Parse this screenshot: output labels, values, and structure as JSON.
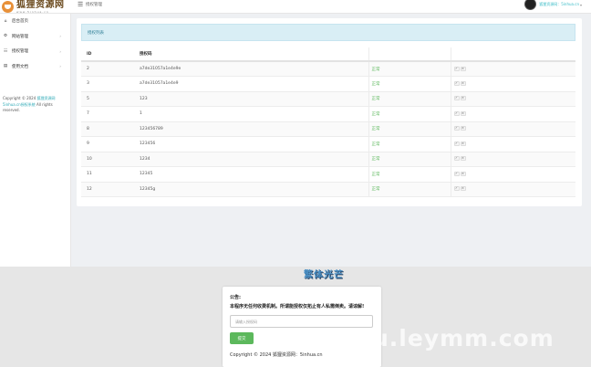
{
  "header": {
    "logo_main": "狐狸资源网",
    "logo_sub": "www.5inhua.cn",
    "menu_icon": "hamburger-icon",
    "page_title": "授权管理",
    "user_name": "狐狸资源网：5inhua.cn",
    "user_caret": "▾"
  },
  "sidebar": {
    "items": [
      {
        "icon": "home-icon",
        "glyph": "⌂",
        "label": "后台首页",
        "arrow": ""
      },
      {
        "icon": "cog-icon",
        "glyph": "⚙",
        "label": "网站管理",
        "arrow": "›"
      },
      {
        "icon": "users-icon",
        "glyph": "☷",
        "label": "授权管理",
        "arrow": "›"
      },
      {
        "icon": "document-icon",
        "glyph": "▤",
        "label": "使用文档",
        "arrow": "›"
      }
    ],
    "copyright_prefix": "Copyright © 2024 ",
    "copyright_link": "狐狸资源网 5inhua.cn授权系统",
    "copyright_suffix": " All rights reserved."
  },
  "main": {
    "alert_text": "授权列表",
    "table": {
      "headers": [
        "ID",
        "授权码",
        "",
        ""
      ],
      "rows": [
        {
          "id": "2",
          "code": "a7de31057a1e4e9e",
          "status": "正常"
        },
        {
          "id": "3",
          "code": "a7de31057a1e4e9",
          "status": "正常"
        },
        {
          "id": "5",
          "code": "123",
          "status": "正常"
        },
        {
          "id": "7",
          "code": "1",
          "status": "正常"
        },
        {
          "id": "8",
          "code": "123456789",
          "status": "正常"
        },
        {
          "id": "9",
          "code": "123456",
          "status": "正常"
        },
        {
          "id": "10",
          "code": "1234",
          "status": "正常"
        },
        {
          "id": "11",
          "code": "12345",
          "status": "正常"
        },
        {
          "id": "12",
          "code": "12345g",
          "status": "正常"
        }
      ],
      "action_edit": "✓",
      "action_delete": "×"
    }
  },
  "lower": {
    "brand": "繁体光芒",
    "watermark": "u.leymm.com",
    "notice_title": "公告:",
    "notice_body": "本程序无任何收费机制。所谓能授权仅拓止有人私需倒卖。请谅解!",
    "input_placeholder": "请输入授权码",
    "button_label": "提交",
    "copyright": "Copyright © 2024 狐狸资源网：5inhua.cn"
  },
  "colors": {
    "accent": "#3bbcc7",
    "status_ok": "#5cb85c",
    "alert_bg": "#d9eef5"
  }
}
